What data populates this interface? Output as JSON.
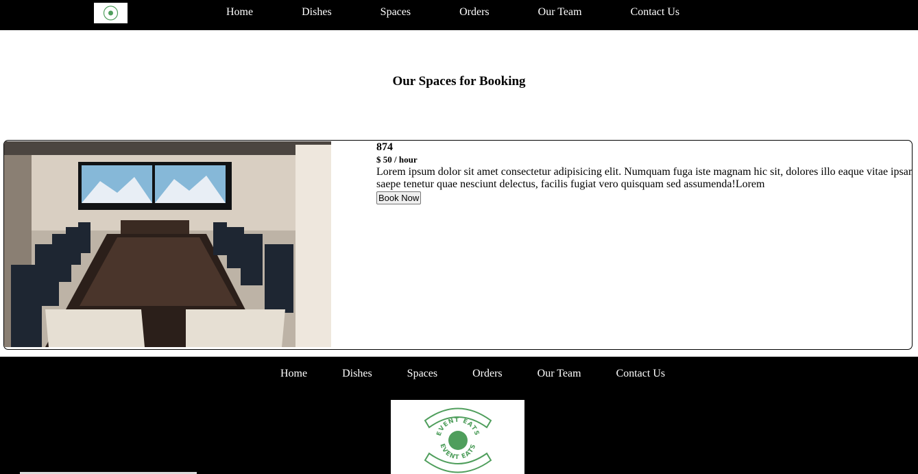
{
  "nav": {
    "items": [
      "Home",
      "Dishes",
      "Spaces",
      "Orders",
      "Our Team",
      "Contact Us"
    ]
  },
  "main": {
    "title": "Our Spaces for Booking",
    "card": {
      "name": "874",
      "price": "$ 50 / hour",
      "description": "Lorem ipsum dolor sit amet consectetur adipisicing elit. Numquam fuga iste magnam hic sit, dolores illo eaque vitae ipsam saepe tenetur quae nesciunt delectus, facilis fugiat vero quisquam sed assumenda!Lorem",
      "button_label": "Book Now"
    }
  },
  "footer": {
    "items": [
      "Home",
      "Dishes",
      "Spaces",
      "Orders",
      "Our Team",
      "Contact Us"
    ],
    "logo_text": "EVENT EATS"
  },
  "colors": {
    "nav_bg": "#000000",
    "logo_green": "#4f9e5c"
  }
}
